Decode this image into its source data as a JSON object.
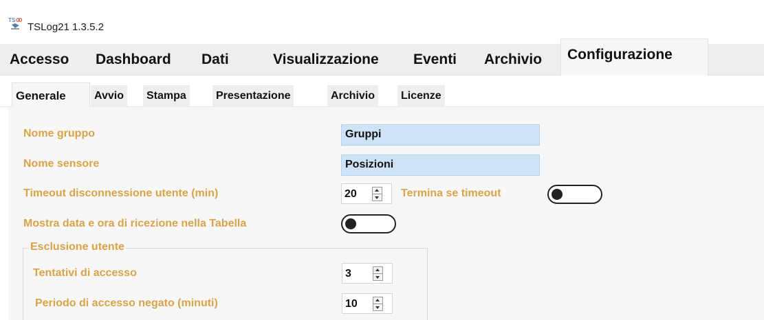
{
  "window": {
    "title": "TSLog21  1.3.5.2",
    "icon": "tslog-app-icon"
  },
  "main_tabs": [
    {
      "label": "Accesso"
    },
    {
      "label": "Dashboard"
    },
    {
      "label": "Dati"
    },
    {
      "label": "Visualizzazione"
    },
    {
      "label": "Eventi"
    },
    {
      "label": "Archivio"
    },
    {
      "label": "Configurazione",
      "active": true
    }
  ],
  "sub_tabs": [
    {
      "label": "Generale",
      "active": true
    },
    {
      "label": "Avvio"
    },
    {
      "label": "Stampa"
    },
    {
      "label": "Presentazione"
    },
    {
      "label": "Archivio"
    },
    {
      "label": "Licenze"
    }
  ],
  "form": {
    "group_name_label": "Nome gruppo",
    "group_name_value": "Gruppi",
    "sensor_name_label": "Nome sensore",
    "sensor_name_value": "Posizioni",
    "timeout_label": "Timeout disconnessione utente (min)",
    "timeout_value": "20",
    "terminate_label": "Termina se timeout",
    "terminate_on": false,
    "show_datetime_label": "Mostra data e ora di ricezione nella Tabella",
    "show_datetime_on": false
  },
  "exclusion": {
    "title": "Esclusione utente",
    "attempts_label": "Tentativi di accesso",
    "attempts_value": "3",
    "denied_period_label": "Periodo di accesso negato (minuti)",
    "denied_period_value": "10"
  },
  "colors": {
    "label_gold": "#d9a347",
    "field_blue": "#cfe3f7",
    "panel_bg": "#f7f7f7",
    "tabbar_bg": "#eeeeee"
  }
}
